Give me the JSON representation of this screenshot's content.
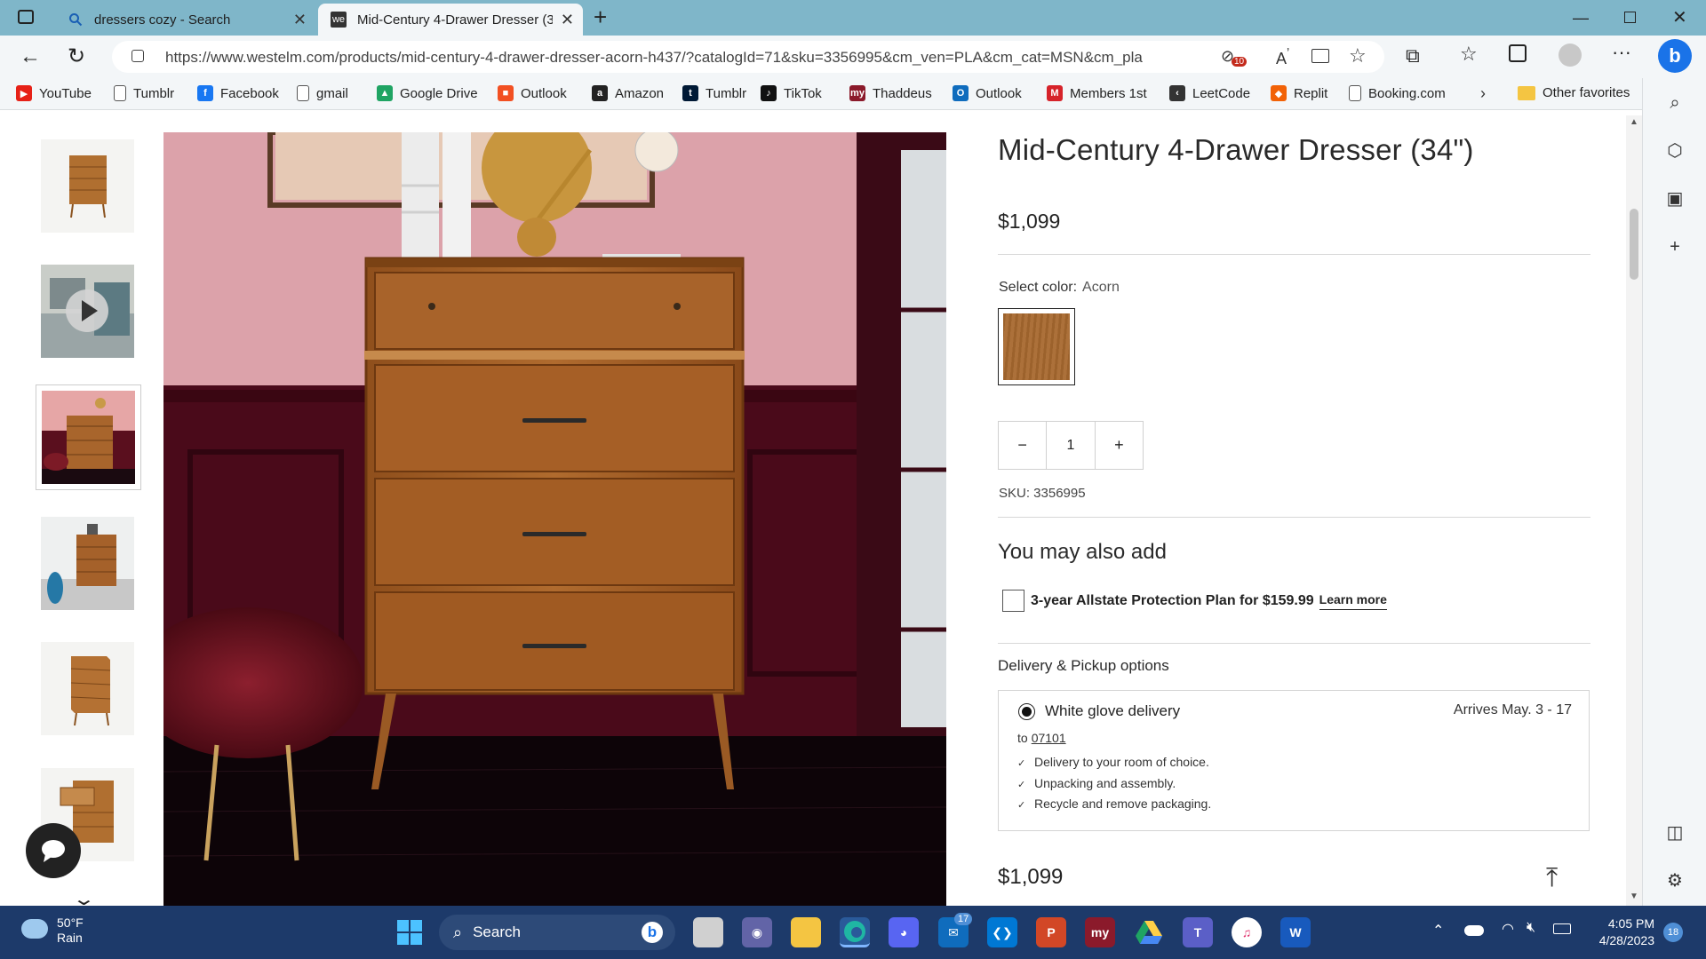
{
  "browser": {
    "tabs": [
      {
        "label": "dressers cozy - Search",
        "icon": "search-icon"
      },
      {
        "label": "Mid-Century 4-Drawer Dresser (3",
        "icon": "we-favicon"
      }
    ],
    "url": "https://www.westelm.com/products/mid-century-4-drawer-dresser-acorn-h437/?catalogId=71&sku=3356995&cm_ven=PLA&cm_cat=MSN&cm_pla...",
    "tracker_badge": "10",
    "favorites": [
      {
        "label": "YouTube",
        "icon": "youtube-icon",
        "color": "#e62117"
      },
      {
        "label": "Tumblr",
        "icon": "page-icon",
        "color": "#555555"
      },
      {
        "label": "Facebook",
        "icon": "facebook-icon",
        "color": "#1877f2"
      },
      {
        "label": "gmail",
        "icon": "page-icon",
        "color": "#555555"
      },
      {
        "label": "Google Drive",
        "icon": "drive-icon",
        "color": "#1fa463"
      },
      {
        "label": "Outlook",
        "icon": "microsoft-icon",
        "color": "#f25022"
      },
      {
        "label": "Amazon",
        "icon": "amazon-icon",
        "color": "#222222"
      },
      {
        "label": "Tumblr",
        "icon": "tumblr-icon",
        "color": "#001935"
      },
      {
        "label": "TikTok",
        "icon": "tiktok-icon",
        "color": "#111111"
      },
      {
        "label": "Thaddeus",
        "icon": "my-icon",
        "color": "#8b1a2b"
      },
      {
        "label": "Outlook",
        "icon": "outlook-icon",
        "color": "#0f6cbd"
      },
      {
        "label": "Members 1st",
        "icon": "m-icon",
        "color": "#d6232a"
      },
      {
        "label": "LeetCode",
        "icon": "leetcode-icon",
        "color": "#333333"
      },
      {
        "label": "Replit",
        "icon": "replit-icon",
        "color": "#f26207"
      },
      {
        "label": "Booking.com",
        "icon": "page-icon",
        "color": "#555555"
      }
    ],
    "other_favorites": "Other favorites"
  },
  "product": {
    "title": "Mid-Century 4-Drawer Dresser (34\")",
    "price": "$1,099",
    "select_color_label": "Select color:",
    "selected_color": "Acorn",
    "swatch_color": "#a8692f",
    "quantity": "1",
    "qty_minus": "−",
    "qty_plus": "+",
    "sku": "SKU: 3356995",
    "also_add_heading": "You may also add",
    "protection_plan": "3-year Allstate Protection Plan for $159.99",
    "learn_more": "Learn more",
    "delivery_heading": "Delivery & Pickup options",
    "delivery_option": "White glove delivery",
    "arrives": "Arrives May. 3 - 17",
    "to_label": "to",
    "zip": "07101",
    "delivery_bullets": [
      "Delivery to your room of choice.",
      "Unpacking and assembly.",
      "Recycle and remove packaging."
    ],
    "price_bottom": "$1,099"
  },
  "taskbar": {
    "weather_temp": "50°F",
    "weather_desc": "Rain",
    "search_label": "Search",
    "mail_badge": "17",
    "time": "4:05 PM",
    "date": "4/28/2023",
    "notification_count": "18"
  }
}
